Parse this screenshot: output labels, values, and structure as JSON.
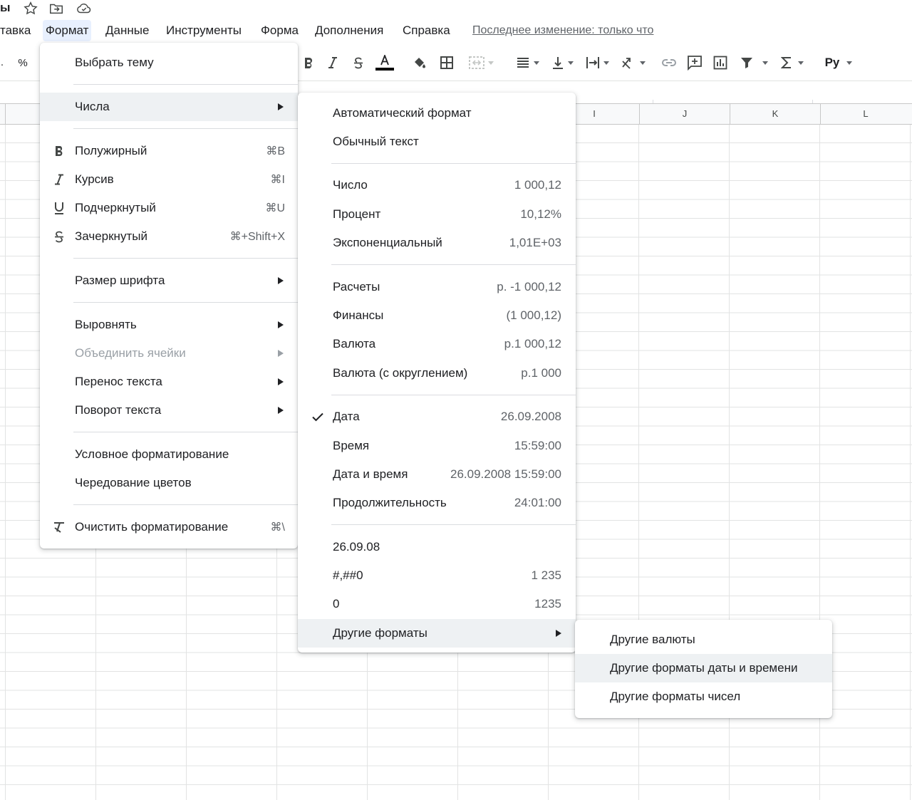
{
  "topbar": {
    "doc_title": "ы",
    "icons": [
      "star-icon",
      "move-to-folder-icon",
      "cloud-saved-icon"
    ]
  },
  "menubar": {
    "items": [
      "тавка",
      "Формат",
      "Данные",
      "Инструменты",
      "Форма",
      "Дополнения",
      "Справка"
    ],
    "active": "Формат",
    "last_edit": "Последнее изменение: только что"
  },
  "toolbar": {
    "percent": "%",
    "currency_style": "Pу"
  },
  "grid": {
    "columns": [
      "I",
      "J",
      "K",
      "L"
    ]
  },
  "format_menu": {
    "items": [
      {
        "label": "Выбрать тему"
      },
      {
        "label": "Числа"
      },
      {
        "label": "Полужирный",
        "shortcut": "⌘B"
      },
      {
        "label": "Курсив",
        "shortcut": "⌘I"
      },
      {
        "label": "Подчеркнутый",
        "shortcut": "⌘U"
      },
      {
        "label": "Зачеркнутый",
        "shortcut": "⌘+Shift+X"
      },
      {
        "label": "Размер шрифта"
      },
      {
        "label": "Выровнять"
      },
      {
        "label": "Объединить ячейки"
      },
      {
        "label": "Перенос текста"
      },
      {
        "label": "Поворот текста"
      },
      {
        "label": "Условное форматирование"
      },
      {
        "label": "Чередование цветов"
      },
      {
        "label": "Очистить форматирование",
        "shortcut": "⌘\\"
      }
    ]
  },
  "numbers_menu": {
    "items": [
      {
        "label": "Автоматический формат",
        "value": ""
      },
      {
        "label": "Обычный текст",
        "value": ""
      },
      {
        "label": "Число",
        "value": "1 000,12"
      },
      {
        "label": "Процент",
        "value": "10,12%"
      },
      {
        "label": "Экспоненциальный",
        "value": "1,01E+03"
      },
      {
        "label": "Расчеты",
        "value": "р. -1 000,12"
      },
      {
        "label": "Финансы",
        "value": "(1 000,12)"
      },
      {
        "label": "Валюта",
        "value": "р.1 000,12"
      },
      {
        "label": "Валюта (с округлением)",
        "value": "р.1 000"
      },
      {
        "label": "Дата",
        "value": "26.09.2008"
      },
      {
        "label": "Время",
        "value": "15:59:00"
      },
      {
        "label": "Дата и время",
        "value": "26.09.2008 15:59:00"
      },
      {
        "label": "Продолжительность",
        "value": "24:01:00"
      },
      {
        "label": "26.09.08",
        "value": ""
      },
      {
        "label": "#,##0",
        "value": "1 235"
      },
      {
        "label": "0",
        "value": "1235"
      },
      {
        "label": "Другие форматы",
        "value": ""
      }
    ],
    "checked": "Дата"
  },
  "other_formats_menu": {
    "items": [
      {
        "label": "Другие валюты"
      },
      {
        "label": "Другие форматы даты и времени"
      },
      {
        "label": "Другие форматы чисел"
      }
    ],
    "highlighted": "Другие форматы даты и времени"
  }
}
